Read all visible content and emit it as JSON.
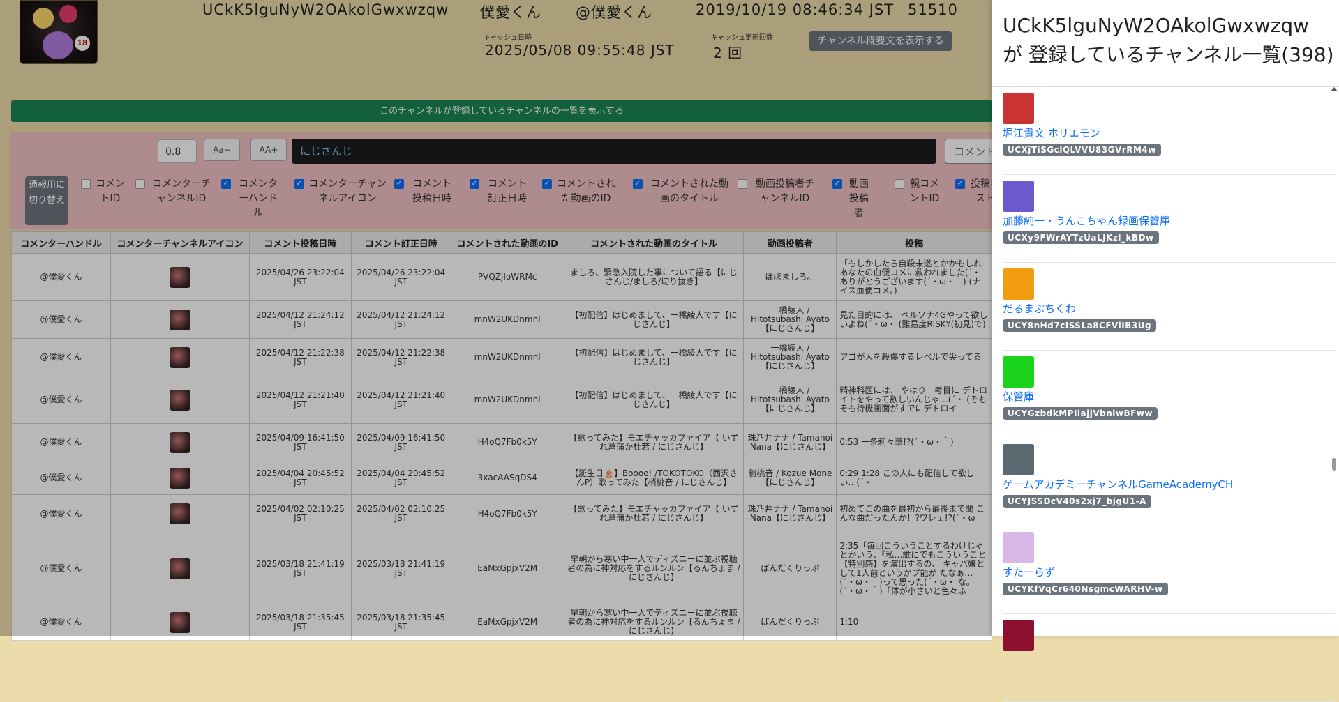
{
  "header": {
    "channel_id": "UCkK5lguNyW2OAkolGwxwzqw",
    "name": "僕愛くん",
    "handle": "@僕愛くん",
    "registered": "2019/10/19 08:46:34 JST",
    "count": "51510",
    "cache_date_label": "キャッシュ日時",
    "cache_date": "2025/05/08 09:55:48 JST",
    "cache_update_label": "キャッシュ更新回数",
    "cache_update": "2 回",
    "summary_button": "チャンネル概要文を表示する"
  },
  "green_button": "このチャンネルが登録しているチャンネルの一覧を表示する",
  "filter": {
    "zoom_value": "0.8",
    "zoom_minus": "Aa−",
    "zoom_plus": "AA+",
    "search_value": "にじさんじ",
    "comment_button": "コメントを",
    "switch_button": "通報用に切り替え",
    "checkboxes": [
      {
        "label": "コメントID",
        "checked": false
      },
      {
        "label": "コメンターチャンネルID",
        "checked": false
      },
      {
        "label": "コメンターハンドル",
        "checked": true
      },
      {
        "label": "コメンターチャンネルアイコン",
        "checked": true
      },
      {
        "label": "コメント投稿日時",
        "checked": true
      },
      {
        "label": "コメント訂正日時",
        "checked": true
      },
      {
        "label": "コメントされた動画のID",
        "checked": true
      },
      {
        "label": "コメントされた動画のタイトル",
        "checked": true
      },
      {
        "label": "動画投稿者チャンネルID",
        "checked": false
      },
      {
        "label": "動画投稿者",
        "checked": true
      },
      {
        "label": "親コメントID",
        "checked": false
      },
      {
        "label": "投稿キスト",
        "checked": true
      }
    ]
  },
  "table": {
    "headers": [
      "コメンターハンドル",
      "コメンターチャンネルアイコン",
      "コメント投稿日時",
      "コメント訂正日時",
      "コメントされた動画のID",
      "コメントされた動画のタイトル",
      "動画投稿者",
      "投稿"
    ],
    "rows": [
      {
        "handle": "@僕愛くん",
        "posted": "2025/04/26 23:22:04 JST",
        "edited": "2025/04/26 23:22:04 JST",
        "video_id": "PVQZjIoWRMc",
        "title": "ましろ、緊急入院した事について語る【にじさんじ/ましろ/切り抜き】",
        "uploader": "ほぼましろ。",
        "text": "「もしかしたら自殺未遂とかかもしれ あなたの血便コメに救われました(´・ ありがとうございます(´・ω・｀) (ナイス血便コメ。)"
      },
      {
        "handle": "@僕愛くん",
        "posted": "2025/04/12 21:24:12 JST",
        "edited": "2025/04/12 21:24:12 JST",
        "video_id": "mnW2UKDnmnI",
        "title": "【初配信】はじめまして、一橋綾人です【にじさんじ】",
        "uploader": "一橋綾人 / Hitotsubashi Ayato【にじさんじ】",
        "text": "見た目的には、 ペルソナ4Gやって欲しいよね(´・ω・ (難易度RISKY(初見)で)"
      },
      {
        "handle": "@僕愛くん",
        "posted": "2025/04/12 21:22:38 JST",
        "edited": "2025/04/12 21:22:38 JST",
        "video_id": "mnW2UKDnmnI",
        "title": "【初配信】はじめまして、一橋綾人です【にじさんじ】",
        "uploader": "一橋綾人 / Hitotsubashi Ayato【にじさんじ】",
        "text": "アゴが人を殺傷するレベルで尖ってる"
      },
      {
        "handle": "@僕愛くん",
        "posted": "2025/04/12 21:21:40 JST",
        "edited": "2025/04/12 21:21:40 JST",
        "video_id": "mnW2UKDnmnI",
        "title": "【初配信】はじめまして、一橋綾人です【にじさんじ】",
        "uploader": "一橋綾人 / Hitotsubashi Ayato【にじさんじ】",
        "text": "精神科医には、 やはり一考目に デトロイトをやって欲しいんじゃ…(´・ (そもそも待機画面がすでにデトロイ"
      },
      {
        "handle": "@僕愛くん",
        "posted": "2025/04/09 16:41:50 JST",
        "edited": "2025/04/09 16:41:50 JST",
        "video_id": "H4oQ7Fb0k5Y",
        "title": "【歌ってみた】モエチャッカファイア【 いずれ菖蒲か杜若 / にじさんじ】",
        "uploader": "珠乃井ナナ / Tamanoi Nana【にじさんじ】",
        "text": "0:53 一条莉々華!?(´・ω・｀)"
      },
      {
        "handle": "@僕愛くん",
        "posted": "2025/04/04 20:45:52 JST",
        "edited": "2025/04/04 20:45:52 JST",
        "video_id": "3xacAASqDS4",
        "title": "【誕生日🎂】Boooo! /TOKOTOKO（西沢さんP）歌ってみた【梢桃音 / にじさんじ】",
        "uploader": "梢桃音 / Kozue Mone【にじさんじ】",
        "text": "0:29 1:28 この人にも配信して欲しい…(´・"
      },
      {
        "handle": "@僕愛くん",
        "posted": "2025/04/02 02:10:25 JST",
        "edited": "2025/04/02 02:10:25 JST",
        "video_id": "H4oQ7Fb0k5Y",
        "title": "【歌ってみた】モエチャッカファイア【 いずれ菖蒲か杜若 / にじさんじ】",
        "uploader": "珠乃井ナナ / Tamanoi Nana【にじさんじ】",
        "text": "初めてこの曲を最初から最後まで聞 こんな曲だったんか！?ワレェ!?(´・ω"
      },
      {
        "handle": "@僕愛くん",
        "posted": "2025/03/18 21:41:19 JST",
        "edited": "2025/03/18 21:41:19 JST",
        "video_id": "EaMxGpjxV2M",
        "title": "早朝から寒い中一人でディズニーに並ぶ視聴者の為に神対応をするルンルン【るんちょま / にじさんじ】",
        "uploader": "ぱんだくりっぷ",
        "text": "2:35「毎回こういうことするわけじゃ とかいう、『私…誰にでもこういうこと 【特別感】を演出するの、 キャバ嬢として1人前というかプ能が たなぁ…(´・ω・｀)って思った(´・ω・ な。(´・ω・｀)「体が小さいと色々ふ"
      },
      {
        "handle": "@僕愛くん",
        "posted": "2025/03/18 21:35:45 JST",
        "edited": "2025/03/18 21:35:45 JST",
        "video_id": "EaMxGpjxV2M",
        "title": "早朝から寒い中一人でディズニーに並ぶ視聴者の為に神対応をするルンルン【るんちょま / にじさんじ】",
        "uploader": "ぱんだくりっぷ",
        "text": "1:10"
      }
    ]
  },
  "panel": {
    "title_line1": "UCkK5lguNyW2OAkolGwxwzqw",
    "title_line2": "が 登録しているチャンネル一覧(398)",
    "channels": [
      {
        "name": "堀江貴文 ホリエモン",
        "id": "UCXjTiSGclQLVVU83GVrRM4w",
        "color": "#c33"
      },
      {
        "name": "加藤純一・うんこちゃん録画保管庫",
        "id": "UCXy9FWrAYTzUaLJKzl_kBDw",
        "color": "#6a5acd"
      },
      {
        "name": "だるまぶちくわ",
        "id": "UCY8nHd7cISSLa8CFViIB3Ug",
        "color": "#f39c12"
      },
      {
        "name": "保管庫",
        "id": "UCYGzbdkMPIlajjVbnlwBFww",
        "color": "#1bd31b"
      },
      {
        "name": "ゲームアカデミーチャンネルGameAcademyCH",
        "id": "UCYJSSDcV40s2xj7_bjgU1-A",
        "color": "#5a6a70"
      },
      {
        "name": "すたーらず",
        "id": "UCYKfVqCr640NsgmcWARHV-w",
        "color": "#d9b8e8"
      },
      {
        "name": "",
        "id": "",
        "color": "#8e1030"
      }
    ]
  }
}
